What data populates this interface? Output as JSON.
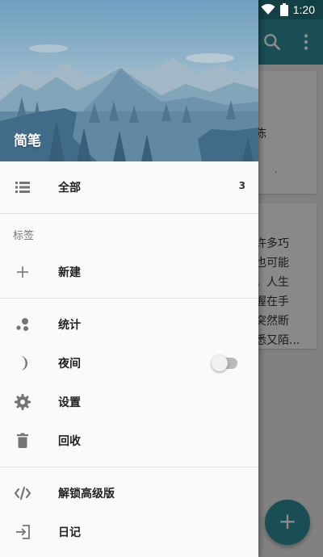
{
  "status_bar": {
    "time": "1:20"
  },
  "background": {
    "card1_lines": [
      "陈",
      "."
    ],
    "card2_lines": [
      "许多巧",
      "也可能",
      "。人生",
      "握在手",
      "突然断",
      "悉又陌..."
    ],
    "fab_label": "+"
  },
  "drawer": {
    "header_title": "简笔",
    "all": {
      "label": "全部",
      "count": "3"
    },
    "tags_header": "标签",
    "new_tag": {
      "label": "新建"
    },
    "stats": {
      "label": "统计"
    },
    "night": {
      "label": "夜间",
      "enabled": false
    },
    "settings": {
      "label": "设置"
    },
    "trash": {
      "label": "回收"
    },
    "unlock": {
      "label": "解锁高级版"
    },
    "diary": {
      "label": "日记"
    }
  },
  "colors": {
    "primary": "#2f8f99",
    "primary_dark": "#24757d",
    "icon_gray": "#757575"
  },
  "icons": {
    "all": "list-icon",
    "new_tag": "plus-icon",
    "stats": "bubbles-icon",
    "night": "moon-icon",
    "settings": "gear-icon",
    "trash": "trash-icon",
    "unlock": "code-icon",
    "diary": "login-icon"
  }
}
